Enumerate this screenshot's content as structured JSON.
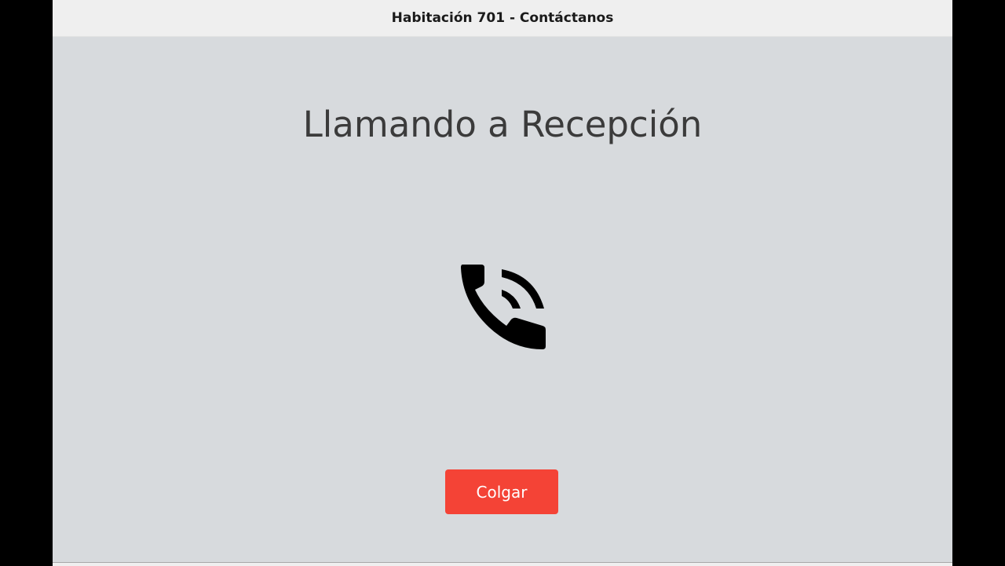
{
  "window": {
    "title": "Habitación 701 - Contáctanos"
  },
  "call": {
    "heading": "Llamando a Recepción",
    "icon": "phone-in-talk-icon",
    "hangup_label": "Colgar"
  },
  "colors": {
    "background": "#d7dadd",
    "titlebar": "#efefef",
    "hangup_button": "#f44336",
    "heading_text": "#3b3b3b",
    "icon": "#000000"
  }
}
